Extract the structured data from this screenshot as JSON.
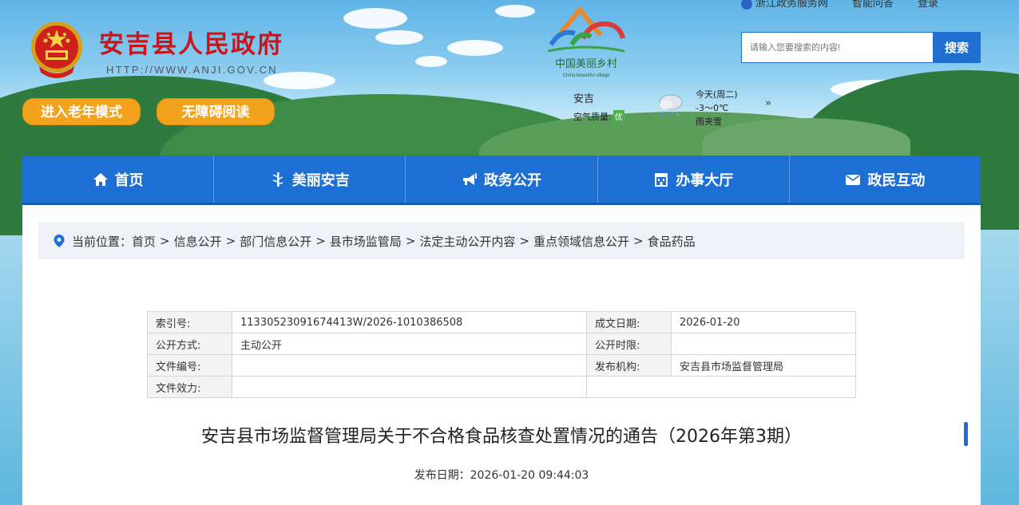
{
  "top_links": {
    "zhejiang": "浙江政务服务网",
    "smart_qa": "智能问答",
    "login": "登录"
  },
  "site": {
    "title": "安吉县人民政府",
    "url": "HTTP://WWW.ANJI.GOV.CN"
  },
  "modes": {
    "elder": "进入老年模式",
    "accessible": "无障碍阅读"
  },
  "logo": {
    "cn": "中国美丽乡村",
    "en": "China beautiful village"
  },
  "search": {
    "placeholder": "请输入您要搜索的内容!",
    "button": "搜索"
  },
  "weather": {
    "city": "安吉",
    "aq_label": "空气质量:",
    "aq_value": "优",
    "day": "今天(周二)",
    "temp": "-3～0℃",
    "desc": "雨夹雪",
    "more": "»"
  },
  "nav": {
    "items": [
      {
        "label": "首页",
        "icon": "home-icon"
      },
      {
        "label": "美丽安吉",
        "icon": "bamboo-icon"
      },
      {
        "label": "政务公开",
        "icon": "megaphone-icon"
      },
      {
        "label": "办事大厅",
        "icon": "building-icon"
      },
      {
        "label": "政民互动",
        "icon": "mail-icon"
      }
    ]
  },
  "breadcrumb": {
    "label": "当前位置：",
    "items": [
      "首页",
      "信息公开",
      "部门信息公开",
      "县市场监管局",
      "法定主动公开内容",
      "重点领域信息公开",
      "食品药品"
    ],
    "separator": ">"
  },
  "meta": {
    "index_label": "索引号:",
    "index_value": "11330523091674413W/2026-1010386508",
    "date_label": "成文日期:",
    "date_value": "2026-01-20",
    "method_label": "公开方式:",
    "method_value": "主动公开",
    "limit_label": "公开时限:",
    "limit_value": "",
    "docno_label": "文件编号:",
    "docno_value": "",
    "org_label": "发布机构:",
    "org_value": "安吉县市场监督管理局",
    "effect_label": "文件效力:",
    "effect_value": ""
  },
  "document": {
    "title": "安吉县市场监督管理局关于不合格食品核查处置情况的通告（2026年第3期）",
    "publish_date": "发布日期：2026-01-20 09:44:03"
  },
  "colors": {
    "brand_blue": "#1d6fd3",
    "title_red": "#c8161d",
    "mode_orange": "#f3a21b"
  }
}
